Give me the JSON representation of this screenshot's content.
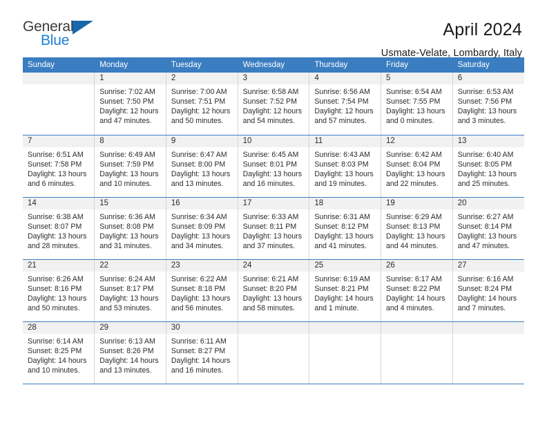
{
  "logo": {
    "text_primary": "General",
    "text_secondary": "Blue",
    "triangle_color": "#1667ab",
    "primary_color": "#3b3b3b",
    "secondary_color": "#1b7fd4"
  },
  "header": {
    "title": "April 2024",
    "subtitle": "Usmate-Velate, Lombardy, Italy"
  },
  "theme": {
    "header_bg": "#3a7dc0",
    "header_text": "#ffffff",
    "daynum_bg": "#f1f1f1",
    "cell_text": "#2b2b2b",
    "divider": "#d4d4d4"
  },
  "weekdays": [
    "Sunday",
    "Monday",
    "Tuesday",
    "Wednesday",
    "Thursday",
    "Friday",
    "Saturday"
  ],
  "labels": {
    "sunrise": "Sunrise:",
    "sunset": "Sunset:",
    "daylight": "Daylight:"
  },
  "weeks": [
    [
      {
        "day": "",
        "empty": true,
        "sunrise": "",
        "sunset": "",
        "daylight_1": "",
        "daylight_2": ""
      },
      {
        "day": "1",
        "sunrise": "Sunrise: 7:02 AM",
        "sunset": "Sunset: 7:50 PM",
        "daylight_1": "Daylight: 12 hours",
        "daylight_2": "and 47 minutes."
      },
      {
        "day": "2",
        "sunrise": "Sunrise: 7:00 AM",
        "sunset": "Sunset: 7:51 PM",
        "daylight_1": "Daylight: 12 hours",
        "daylight_2": "and 50 minutes."
      },
      {
        "day": "3",
        "sunrise": "Sunrise: 6:58 AM",
        "sunset": "Sunset: 7:52 PM",
        "daylight_1": "Daylight: 12 hours",
        "daylight_2": "and 54 minutes."
      },
      {
        "day": "4",
        "sunrise": "Sunrise: 6:56 AM",
        "sunset": "Sunset: 7:54 PM",
        "daylight_1": "Daylight: 12 hours",
        "daylight_2": "and 57 minutes."
      },
      {
        "day": "5",
        "sunrise": "Sunrise: 6:54 AM",
        "sunset": "Sunset: 7:55 PM",
        "daylight_1": "Daylight: 13 hours",
        "daylight_2": "and 0 minutes."
      },
      {
        "day": "6",
        "sunrise": "Sunrise: 6:53 AM",
        "sunset": "Sunset: 7:56 PM",
        "daylight_1": "Daylight: 13 hours",
        "daylight_2": "and 3 minutes."
      }
    ],
    [
      {
        "day": "7",
        "sunrise": "Sunrise: 6:51 AM",
        "sunset": "Sunset: 7:58 PM",
        "daylight_1": "Daylight: 13 hours",
        "daylight_2": "and 6 minutes."
      },
      {
        "day": "8",
        "sunrise": "Sunrise: 6:49 AM",
        "sunset": "Sunset: 7:59 PM",
        "daylight_1": "Daylight: 13 hours",
        "daylight_2": "and 10 minutes."
      },
      {
        "day": "9",
        "sunrise": "Sunrise: 6:47 AM",
        "sunset": "Sunset: 8:00 PM",
        "daylight_1": "Daylight: 13 hours",
        "daylight_2": "and 13 minutes."
      },
      {
        "day": "10",
        "sunrise": "Sunrise: 6:45 AM",
        "sunset": "Sunset: 8:01 PM",
        "daylight_1": "Daylight: 13 hours",
        "daylight_2": "and 16 minutes."
      },
      {
        "day": "11",
        "sunrise": "Sunrise: 6:43 AM",
        "sunset": "Sunset: 8:03 PM",
        "daylight_1": "Daylight: 13 hours",
        "daylight_2": "and 19 minutes."
      },
      {
        "day": "12",
        "sunrise": "Sunrise: 6:42 AM",
        "sunset": "Sunset: 8:04 PM",
        "daylight_1": "Daylight: 13 hours",
        "daylight_2": "and 22 minutes."
      },
      {
        "day": "13",
        "sunrise": "Sunrise: 6:40 AM",
        "sunset": "Sunset: 8:05 PM",
        "daylight_1": "Daylight: 13 hours",
        "daylight_2": "and 25 minutes."
      }
    ],
    [
      {
        "day": "14",
        "sunrise": "Sunrise: 6:38 AM",
        "sunset": "Sunset: 8:07 PM",
        "daylight_1": "Daylight: 13 hours",
        "daylight_2": "and 28 minutes."
      },
      {
        "day": "15",
        "sunrise": "Sunrise: 6:36 AM",
        "sunset": "Sunset: 8:08 PM",
        "daylight_1": "Daylight: 13 hours",
        "daylight_2": "and 31 minutes."
      },
      {
        "day": "16",
        "sunrise": "Sunrise: 6:34 AM",
        "sunset": "Sunset: 8:09 PM",
        "daylight_1": "Daylight: 13 hours",
        "daylight_2": "and 34 minutes."
      },
      {
        "day": "17",
        "sunrise": "Sunrise: 6:33 AM",
        "sunset": "Sunset: 8:11 PM",
        "daylight_1": "Daylight: 13 hours",
        "daylight_2": "and 37 minutes."
      },
      {
        "day": "18",
        "sunrise": "Sunrise: 6:31 AM",
        "sunset": "Sunset: 8:12 PM",
        "daylight_1": "Daylight: 13 hours",
        "daylight_2": "and 41 minutes."
      },
      {
        "day": "19",
        "sunrise": "Sunrise: 6:29 AM",
        "sunset": "Sunset: 8:13 PM",
        "daylight_1": "Daylight: 13 hours",
        "daylight_2": "and 44 minutes."
      },
      {
        "day": "20",
        "sunrise": "Sunrise: 6:27 AM",
        "sunset": "Sunset: 8:14 PM",
        "daylight_1": "Daylight: 13 hours",
        "daylight_2": "and 47 minutes."
      }
    ],
    [
      {
        "day": "21",
        "sunrise": "Sunrise: 6:26 AM",
        "sunset": "Sunset: 8:16 PM",
        "daylight_1": "Daylight: 13 hours",
        "daylight_2": "and 50 minutes."
      },
      {
        "day": "22",
        "sunrise": "Sunrise: 6:24 AM",
        "sunset": "Sunset: 8:17 PM",
        "daylight_1": "Daylight: 13 hours",
        "daylight_2": "and 53 minutes."
      },
      {
        "day": "23",
        "sunrise": "Sunrise: 6:22 AM",
        "sunset": "Sunset: 8:18 PM",
        "daylight_1": "Daylight: 13 hours",
        "daylight_2": "and 56 minutes."
      },
      {
        "day": "24",
        "sunrise": "Sunrise: 6:21 AM",
        "sunset": "Sunset: 8:20 PM",
        "daylight_1": "Daylight: 13 hours",
        "daylight_2": "and 58 minutes."
      },
      {
        "day": "25",
        "sunrise": "Sunrise: 6:19 AM",
        "sunset": "Sunset: 8:21 PM",
        "daylight_1": "Daylight: 14 hours",
        "daylight_2": "and 1 minute."
      },
      {
        "day": "26",
        "sunrise": "Sunrise: 6:17 AM",
        "sunset": "Sunset: 8:22 PM",
        "daylight_1": "Daylight: 14 hours",
        "daylight_2": "and 4 minutes."
      },
      {
        "day": "27",
        "sunrise": "Sunrise: 6:16 AM",
        "sunset": "Sunset: 8:24 PM",
        "daylight_1": "Daylight: 14 hours",
        "daylight_2": "and 7 minutes."
      }
    ],
    [
      {
        "day": "28",
        "sunrise": "Sunrise: 6:14 AM",
        "sunset": "Sunset: 8:25 PM",
        "daylight_1": "Daylight: 14 hours",
        "daylight_2": "and 10 minutes."
      },
      {
        "day": "29",
        "sunrise": "Sunrise: 6:13 AM",
        "sunset": "Sunset: 8:26 PM",
        "daylight_1": "Daylight: 14 hours",
        "daylight_2": "and 13 minutes."
      },
      {
        "day": "30",
        "sunrise": "Sunrise: 6:11 AM",
        "sunset": "Sunset: 8:27 PM",
        "daylight_1": "Daylight: 14 hours",
        "daylight_2": "and 16 minutes."
      },
      {
        "day": "",
        "empty": true,
        "sunrise": "",
        "sunset": "",
        "daylight_1": "",
        "daylight_2": ""
      },
      {
        "day": "",
        "empty": true,
        "sunrise": "",
        "sunset": "",
        "daylight_1": "",
        "daylight_2": ""
      },
      {
        "day": "",
        "empty": true,
        "sunrise": "",
        "sunset": "",
        "daylight_1": "",
        "daylight_2": ""
      },
      {
        "day": "",
        "empty": true,
        "sunrise": "",
        "sunset": "",
        "daylight_1": "",
        "daylight_2": ""
      }
    ]
  ]
}
